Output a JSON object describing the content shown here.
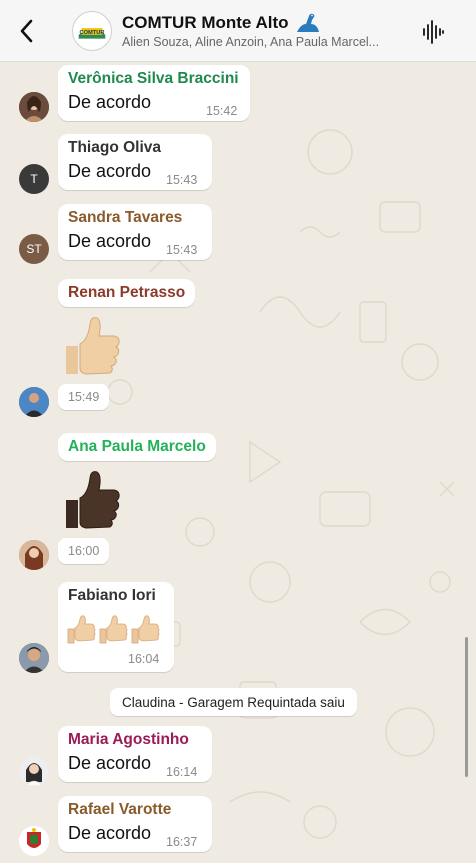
{
  "header": {
    "back_glyph": "‹",
    "group_avatar_text": "COMTUR",
    "title": "COMTUR Monte Alto",
    "title_emoji_icon": "dinosaur-icon",
    "subtitle": "Alien Souza, Aline Anzoin, Ana Paula Marcel...",
    "audio_icon": "audio-wave-icon"
  },
  "colors": {
    "green_name": "#1f8a4c",
    "bright_green_name": "#25b15a",
    "brown_name": "#8a5a2b",
    "purple_name": "#9b1b57",
    "renan_name": "#8c3b2a",
    "chat_bg": "#efeae2"
  },
  "messages": [
    {
      "sender": "Verônica Silva Braccini",
      "text": "De acordo",
      "time": "15:42"
    },
    {
      "sender": "Thiago Oliva",
      "text": "De acordo",
      "time": "15:43",
      "avatar_initial": "T"
    },
    {
      "sender": "Sandra Tavares",
      "text": "De acordo",
      "time": "15:43",
      "avatar_initial": "ST"
    },
    {
      "sender": "Renan Petrasso",
      "time": "15:49",
      "sticker": "thumbs-up-light-icon"
    },
    {
      "sender": "Ana Paula Marcelo",
      "time": "16:00",
      "sticker": "thumbs-up-dark-icon"
    },
    {
      "sender": "Fabiano Iori",
      "time": "16:04",
      "sticker": "three-thumbs-up-icon"
    },
    {
      "sender": "Maria Agostinho",
      "text": "De acordo",
      "time": "16:14"
    },
    {
      "sender": "Rafael Varotte",
      "text": "De acordo",
      "time": "16:37"
    }
  ],
  "system_message": "Claudina - Garagem Requintada saiu"
}
